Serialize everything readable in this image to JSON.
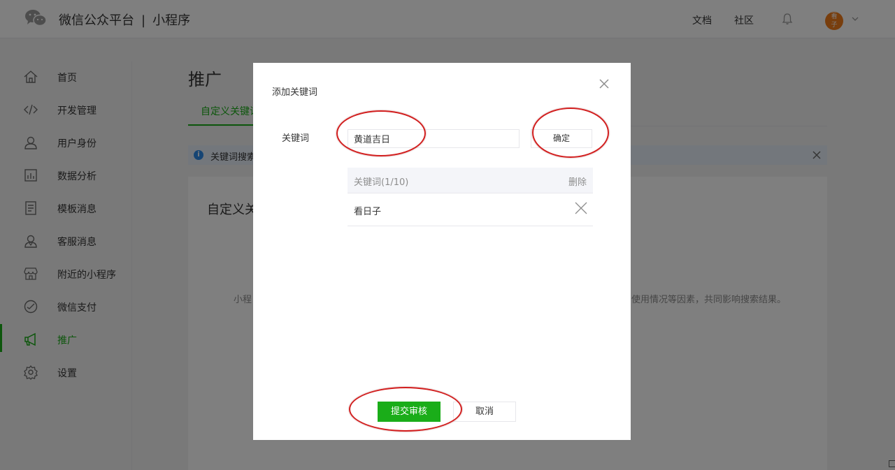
{
  "header": {
    "brand": "微信公众平台",
    "separator": "|",
    "product": "小程序",
    "links": [
      "文档",
      "社区"
    ],
    "avatar_text": [
      "看",
      "子"
    ]
  },
  "sidebar": {
    "items": [
      {
        "label": "首页",
        "icon": "home-icon"
      },
      {
        "label": "开发管理",
        "icon": "code-icon"
      },
      {
        "label": "用户身份",
        "icon": "user-icon"
      },
      {
        "label": "数据分析",
        "icon": "bar-chart-icon"
      },
      {
        "label": "模板消息",
        "icon": "document-icon"
      },
      {
        "label": "客服消息",
        "icon": "customer-service-icon"
      },
      {
        "label": "附近的小程序",
        "icon": "store-icon"
      },
      {
        "label": "微信支付",
        "icon": "payment-icon"
      },
      {
        "label": "推广",
        "icon": "megaphone-icon",
        "active": true
      },
      {
        "label": "设置",
        "icon": "gear-icon"
      }
    ]
  },
  "main": {
    "title": "推广",
    "tab": "自定义关键词",
    "notice": "关键词搜索",
    "panel_title": "自定义关",
    "description_left": "小程",
    "description_right": "使用情况等因素，共同影响搜索结果。"
  },
  "dialog": {
    "title": "添加关键词",
    "field_label": "关键词",
    "input_value": "黄道吉日",
    "confirm_label": "确定",
    "table_header": "关键词(1/10)",
    "delete_header": "删除",
    "rows": [
      "看日子"
    ],
    "submit_label": "提交审核",
    "cancel_label": "取消"
  },
  "colors": {
    "accent": "#1aad19",
    "annotation": "#d21f1f",
    "info": "#2d8ae8"
  }
}
